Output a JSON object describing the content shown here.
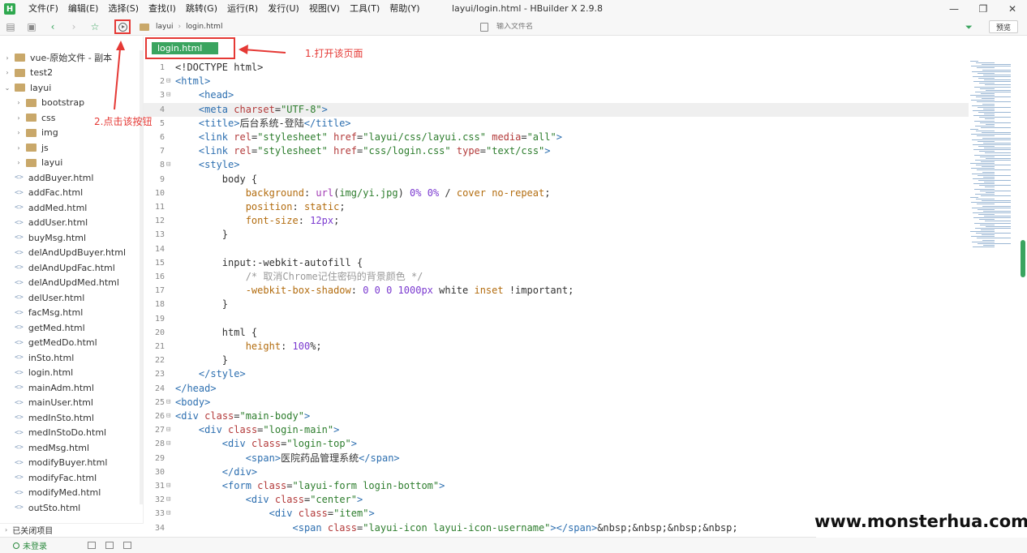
{
  "window": {
    "title": "layui/login.html - HBuilder X 2.9.8",
    "logo_letter": "H",
    "controls": [
      "—",
      "❐",
      "✕"
    ]
  },
  "menu": [
    "文件(F)",
    "编辑(E)",
    "选择(S)",
    "查找(I)",
    "跳转(G)",
    "运行(R)",
    "发行(U)",
    "视图(V)",
    "工具(T)",
    "帮助(Y)"
  ],
  "breadcrumb": {
    "folder": "layui",
    "file": "login.html"
  },
  "file_search": {
    "placeholder": "输入文件名"
  },
  "preview_label": "预览",
  "sidebar": {
    "tree": [
      {
        "label": "vue-原始文件 - 副本",
        "kind": "folder",
        "level": 0,
        "chevron": "›"
      },
      {
        "label": "test2",
        "kind": "folder",
        "level": 0,
        "chevron": "›"
      },
      {
        "label": "layui",
        "kind": "folder",
        "level": 0,
        "chevron": "⌄"
      },
      {
        "label": "bootstrap",
        "kind": "folder",
        "level": 1,
        "chevron": "›"
      },
      {
        "label": "css",
        "kind": "folder",
        "level": 1,
        "chevron": "›"
      },
      {
        "label": "img",
        "kind": "folder",
        "level": 1,
        "chevron": "›"
      },
      {
        "label": "js",
        "kind": "folder",
        "level": 1,
        "chevron": "›"
      },
      {
        "label": "layui",
        "kind": "folder",
        "level": 1,
        "chevron": "›"
      },
      {
        "label": "addBuyer.html",
        "kind": "file",
        "level": 1
      },
      {
        "label": "addFac.html",
        "kind": "file",
        "level": 1
      },
      {
        "label": "addMed.html",
        "kind": "file",
        "level": 1
      },
      {
        "label": "addUser.html",
        "kind": "file",
        "level": 1
      },
      {
        "label": "buyMsg.html",
        "kind": "file",
        "level": 1
      },
      {
        "label": "delAndUpdBuyer.html",
        "kind": "file",
        "level": 1
      },
      {
        "label": "delAndUpdFac.html",
        "kind": "file",
        "level": 1
      },
      {
        "label": "delAndUpdMed.html",
        "kind": "file",
        "level": 1
      },
      {
        "label": "delUser.html",
        "kind": "file",
        "level": 1
      },
      {
        "label": "facMsg.html",
        "kind": "file",
        "level": 1
      },
      {
        "label": "getMed.html",
        "kind": "file",
        "level": 1
      },
      {
        "label": "getMedDo.html",
        "kind": "file",
        "level": 1
      },
      {
        "label": "inSto.html",
        "kind": "file",
        "level": 1
      },
      {
        "label": "login.html",
        "kind": "file",
        "level": 1
      },
      {
        "label": "mainAdm.html",
        "kind": "file",
        "level": 1
      },
      {
        "label": "mainUser.html",
        "kind": "file",
        "level": 1
      },
      {
        "label": "medInSto.html",
        "kind": "file",
        "level": 1
      },
      {
        "label": "medInStoDo.html",
        "kind": "file",
        "level": 1
      },
      {
        "label": "medMsg.html",
        "kind": "file",
        "level": 1
      },
      {
        "label": "modifyBuyer.html",
        "kind": "file",
        "level": 1
      },
      {
        "label": "modifyFac.html",
        "kind": "file",
        "level": 1
      },
      {
        "label": "modifyMed.html",
        "kind": "file",
        "level": 1
      },
      {
        "label": "outSto.html",
        "kind": "file",
        "level": 1
      }
    ],
    "closed_projects": "已关闭项目",
    "file_tag": "<>"
  },
  "status": {
    "login": "未登录"
  },
  "tab": {
    "label": "login.html"
  },
  "annotations": {
    "open_page": "1.打开该页面",
    "click_button": "2.点击该按钮"
  },
  "watermark": "www.monsterhua.com",
  "editor": {
    "active_line": 4,
    "lines": [
      {
        "n": 1,
        "fold": "",
        "html": "<span class='c-sel'>&lt;!DOCTYPE html&gt;</span>"
      },
      {
        "n": 2,
        "fold": "⊟",
        "html": "<span class='c-tag'>&lt;html&gt;</span>"
      },
      {
        "n": 3,
        "fold": "⊟",
        "html": "    <span class='c-tag'>&lt;head&gt;</span>"
      },
      {
        "n": 4,
        "fold": "",
        "html": "    <span class='c-tag'>&lt;meta</span> <span class='c-attr'>charset</span>=<span class='c-str'>\"UTF-8\"</span><span class='c-tag'>&gt;</span>"
      },
      {
        "n": 5,
        "fold": "",
        "html": "    <span class='c-tag'>&lt;title&gt;</span>后台系统-登陆<span class='c-tag'>&lt;/title&gt;</span>"
      },
      {
        "n": 6,
        "fold": "",
        "html": "    <span class='c-tag'>&lt;link</span> <span class='c-attr'>rel</span>=<span class='c-str'>\"stylesheet\"</span> <span class='c-attr'>href</span>=<span class='c-str'>\"layui/css/layui.css\"</span> <span class='c-attr'>media</span>=<span class='c-str'>\"all\"</span><span class='c-tag'>&gt;</span>"
      },
      {
        "n": 7,
        "fold": "",
        "html": "    <span class='c-tag'>&lt;link</span> <span class='c-attr'>rel</span>=<span class='c-str'>\"stylesheet\"</span> <span class='c-attr'>href</span>=<span class='c-str'>\"css/login.css\"</span> <span class='c-attr'>type</span>=<span class='c-str'>\"text/css\"</span><span class='c-tag'>&gt;</span>"
      },
      {
        "n": 8,
        "fold": "⊟",
        "html": "    <span class='c-tag'>&lt;style&gt;</span>"
      },
      {
        "n": 9,
        "fold": "",
        "html": "        body {"
      },
      {
        "n": 10,
        "fold": "",
        "html": "            <span class='c-prop'>background</span>: <span class='c-val'>url</span>(<span class='c-str'>img/yi.jpg</span>) <span class='c-num'>0%</span> <span class='c-num'>0%</span> / <span class='c-prop'>cover no-repeat</span>;"
      },
      {
        "n": 11,
        "fold": "",
        "html": "            <span class='c-prop'>position</span>: <span class='c-prop'>static</span>;"
      },
      {
        "n": 12,
        "fold": "",
        "html": "            <span class='c-prop'>font-size</span>: <span class='c-num'>12px</span>;"
      },
      {
        "n": 13,
        "fold": "",
        "html": "        }"
      },
      {
        "n": 14,
        "fold": "",
        "html": ""
      },
      {
        "n": 15,
        "fold": "",
        "html": "        input:-webkit-autofill {"
      },
      {
        "n": 16,
        "fold": "",
        "html": "            <span class='c-cmt'>/* 取消Chrome记住密码的背景颜色 */</span>"
      },
      {
        "n": 17,
        "fold": "",
        "html": "            <span class='c-prop'>-webkit-box-shadow</span>: <span class='c-num'>0 0 0 1000px</span> white <span class='c-prop'>inset</span> !important;"
      },
      {
        "n": 18,
        "fold": "",
        "html": "        }"
      },
      {
        "n": 19,
        "fold": "",
        "html": ""
      },
      {
        "n": 20,
        "fold": "",
        "html": "        html {"
      },
      {
        "n": 21,
        "fold": "",
        "html": "            <span class='c-prop'>height</span>: <span class='c-num'>100</span>%;"
      },
      {
        "n": 22,
        "fold": "",
        "html": "        }"
      },
      {
        "n": 23,
        "fold": "",
        "html": "    <span class='c-tag'>&lt;/style&gt;</span>"
      },
      {
        "n": 24,
        "fold": "",
        "html": "<span class='c-tag'>&lt;/head&gt;</span>"
      },
      {
        "n": 25,
        "fold": "⊟",
        "html": "<span class='c-tag'>&lt;body&gt;</span>"
      },
      {
        "n": 26,
        "fold": "⊟",
        "html": "<span class='c-tag'>&lt;div</span> <span class='c-attr'>class</span>=<span class='c-str'>\"main-body\"</span><span class='c-tag'>&gt;</span>"
      },
      {
        "n": 27,
        "fold": "⊟",
        "html": "    <span class='c-tag'>&lt;div</span> <span class='c-attr'>class</span>=<span class='c-str'>\"login-main\"</span><span class='c-tag'>&gt;</span>"
      },
      {
        "n": 28,
        "fold": "⊟",
        "html": "        <span class='c-tag'>&lt;div</span> <span class='c-attr'>class</span>=<span class='c-str'>\"login-top\"</span><span class='c-tag'>&gt;</span>"
      },
      {
        "n": 29,
        "fold": "",
        "html": "            <span class='c-tag'>&lt;span&gt;</span>医院药品管理系统<span class='c-tag'>&lt;/span&gt;</span>"
      },
      {
        "n": 30,
        "fold": "",
        "html": "        <span class='c-tag'>&lt;/div&gt;</span>"
      },
      {
        "n": 31,
        "fold": "⊟",
        "html": "        <span class='c-tag'>&lt;form</span> <span class='c-attr'>class</span>=<span class='c-str'>\"layui-form login-bottom\"</span><span class='c-tag'>&gt;</span>"
      },
      {
        "n": 32,
        "fold": "⊟",
        "html": "            <span class='c-tag'>&lt;div</span> <span class='c-attr'>class</span>=<span class='c-str'>\"center\"</span><span class='c-tag'>&gt;</span>"
      },
      {
        "n": 33,
        "fold": "⊟",
        "html": "                <span class='c-tag'>&lt;div</span> <span class='c-attr'>class</span>=<span class='c-str'>\"item\"</span><span class='c-tag'>&gt;</span>"
      },
      {
        "n": 34,
        "fold": "",
        "html": "                    <span class='c-tag'>&lt;span</span> <span class='c-attr'>class</span>=<span class='c-str'>\"layui-icon layui-icon-username\"</span><span class='c-tag'>&gt;&lt;/span&gt;</span>&amp;nbsp;&amp;nbsp;&amp;nbsp;&amp;nbsp;"
      }
    ]
  }
}
